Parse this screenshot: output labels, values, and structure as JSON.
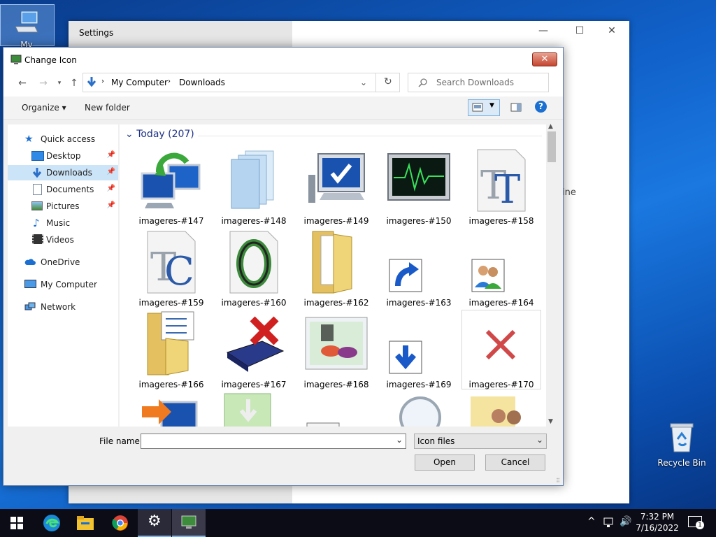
{
  "desktop": {
    "icons": [
      {
        "label": "My Computer"
      },
      {
        "label": "Recycle Bin"
      }
    ]
  },
  "settings_window": {
    "title": "Settings",
    "minimize": "—",
    "maximize": "☐",
    "close": "✕",
    "fragment_text": "ine"
  },
  "dialog": {
    "title": "Change Icon",
    "close": "✕",
    "address": {
      "segments": [
        "My Computer",
        "Downloads"
      ],
      "separator": ">"
    },
    "search_placeholder": "Search Downloads",
    "toolbar": {
      "organize": "Organize",
      "new_folder": "New folder",
      "help": "?"
    },
    "nav_pane": {
      "items": [
        {
          "label": "Quick access",
          "icon": "star-icon"
        },
        {
          "label": "Desktop",
          "icon": "desktop-icon",
          "pinned": true
        },
        {
          "label": "Downloads",
          "icon": "download-arrow-icon",
          "pinned": true,
          "selected": true
        },
        {
          "label": "Documents",
          "icon": "documents-icon",
          "pinned": true
        },
        {
          "label": "Pictures",
          "icon": "pictures-icon",
          "pinned": true
        },
        {
          "label": "Music",
          "icon": "music-icon"
        },
        {
          "label": "Videos",
          "icon": "videos-icon"
        },
        {
          "label": "OneDrive",
          "icon": "cloud-icon"
        },
        {
          "label": "My Computer",
          "icon": "computer-icon"
        },
        {
          "label": "Network",
          "icon": "network-icon"
        }
      ]
    },
    "group_header": "Today (207)",
    "files": [
      {
        "name": "imageres-#147",
        "icon": "network-computers-icon"
      },
      {
        "name": "imageres-#148",
        "icon": "stacked-windows-icon"
      },
      {
        "name": "imageres-#149",
        "icon": "monitor-checkmark-icon"
      },
      {
        "name": "imageres-#150",
        "icon": "performance-monitor-icon"
      },
      {
        "name": "imageres-#158",
        "icon": "truetype-font-icon"
      },
      {
        "name": "imageres-#159",
        "icon": "truetype-collection-font-icon"
      },
      {
        "name": "imageres-#160",
        "icon": "opentype-font-icon"
      },
      {
        "name": "imageres-#162",
        "icon": "folder-documents-icon"
      },
      {
        "name": "imageres-#163",
        "icon": "shortcut-arrow-icon"
      },
      {
        "name": "imageres-#164",
        "icon": "users-icon"
      },
      {
        "name": "imageres-#166",
        "icon": "folder-checklist-icon"
      },
      {
        "name": "imageres-#167",
        "icon": "drive-delete-icon"
      },
      {
        "name": "imageres-#168",
        "icon": "paint-palette-icon"
      },
      {
        "name": "imageres-#169",
        "icon": "download-arrow-icon"
      },
      {
        "name": "imageres-#170",
        "icon": "red-x-icon"
      }
    ],
    "partial_icons": [
      "folder-arrow-icon",
      "green-download-icon",
      "window-icon",
      "magnifier-icon",
      "people-icon"
    ],
    "file_name_label": "File name:",
    "file_name_value": "",
    "file_type": "Icon files",
    "open_button": "Open",
    "cancel_button": "Cancel"
  },
  "taskbar": {
    "apps": [
      "windows-start-icon",
      "edge-icon",
      "file-explorer-icon",
      "chrome-icon",
      "settings-gear-icon",
      "monitor-app-icon"
    ],
    "time": "7:32 PM",
    "date": "7/16/2022",
    "notification_count": "1"
  }
}
